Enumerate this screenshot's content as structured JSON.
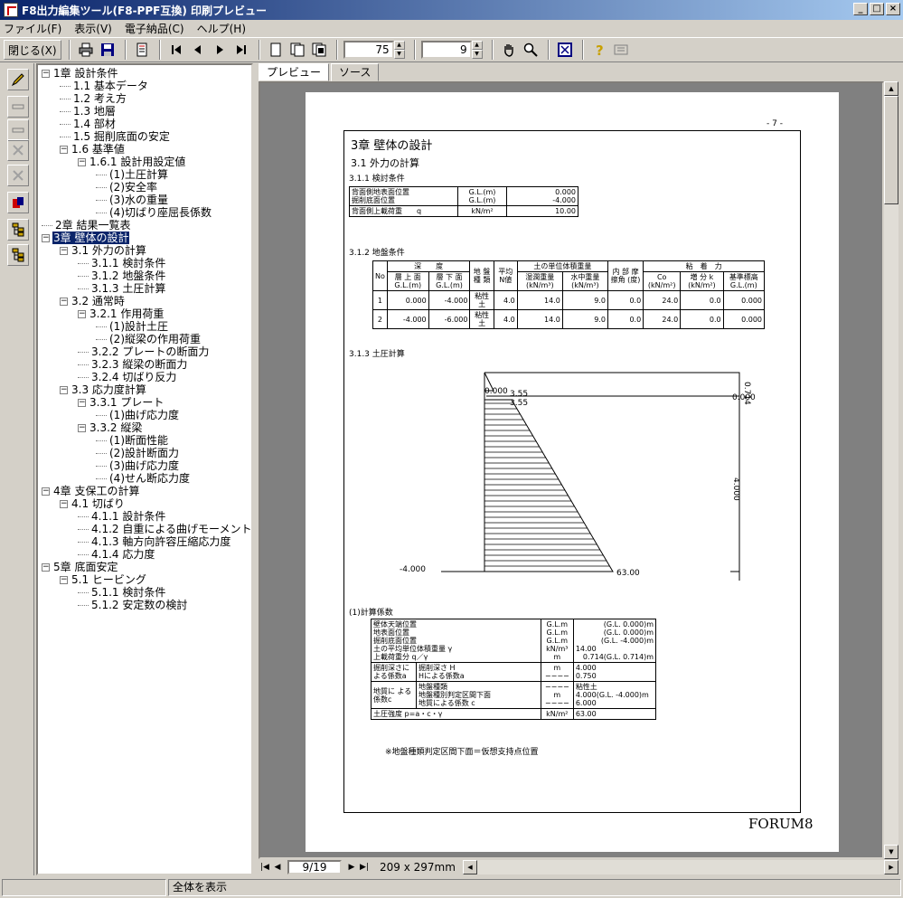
{
  "window": {
    "title": "F8出力編集ツール(F8-PPF互換) 印刷プレビュー"
  },
  "menu": [
    "ファイル(F)",
    "表示(V)",
    "電子納品(C)",
    "ヘルプ(H)"
  ],
  "toolbar": {
    "close_label": "閉じる(X)",
    "zoom_value": "75",
    "page_count_value": "9"
  },
  "tree": [
    {
      "label": "1章 設計条件",
      "level": 0,
      "box": "−"
    },
    {
      "label": "1.1 基本データ",
      "level": 1
    },
    {
      "label": "1.2 考え方",
      "level": 1
    },
    {
      "label": "1.3 地層",
      "level": 1
    },
    {
      "label": "1.4 部材",
      "level": 1
    },
    {
      "label": "1.5 掘削底面の安定",
      "level": 1
    },
    {
      "label": "1.6 基準値",
      "level": 1,
      "box": "−"
    },
    {
      "label": "1.6.1 設計用設定値",
      "level": 2,
      "box": "−"
    },
    {
      "label": "(1)土圧計算",
      "level": 3
    },
    {
      "label": "(2)安全率",
      "level": 3
    },
    {
      "label": "(3)水の重量",
      "level": 3
    },
    {
      "label": "(4)切ばり座屈長係数",
      "level": 3
    },
    {
      "label": "2章 結果一覧表",
      "level": 0
    },
    {
      "label": "3章 壁体の設計",
      "level": 0,
      "box": "−",
      "selected": true
    },
    {
      "label": "3.1 外力の計算",
      "level": 1,
      "box": "−"
    },
    {
      "label": "3.1.1 検討条件",
      "level": 2
    },
    {
      "label": "3.1.2 地盤条件",
      "level": 2
    },
    {
      "label": "3.1.3 土圧計算",
      "level": 2
    },
    {
      "label": "3.2 通常時",
      "level": 1,
      "box": "−"
    },
    {
      "label": "3.2.1 作用荷重",
      "level": 2,
      "box": "−"
    },
    {
      "label": "(1)設計土圧",
      "level": 3
    },
    {
      "label": "(2)縦梁の作用荷重",
      "level": 3
    },
    {
      "label": "3.2.2 プレートの断面力",
      "level": 2
    },
    {
      "label": "3.2.3 縦梁の断面力",
      "level": 2
    },
    {
      "label": "3.2.4 切ばり反力",
      "level": 2
    },
    {
      "label": "3.3 応力度計算",
      "level": 1,
      "box": "−"
    },
    {
      "label": "3.3.1 プレート",
      "level": 2,
      "box": "−"
    },
    {
      "label": "(1)曲げ応力度",
      "level": 3
    },
    {
      "label": "3.3.2 縦梁",
      "level": 2,
      "box": "−"
    },
    {
      "label": "(1)断面性能",
      "level": 3
    },
    {
      "label": "(2)設計断面力",
      "level": 3
    },
    {
      "label": "(3)曲げ応力度",
      "level": 3
    },
    {
      "label": "(4)せん断応力度",
      "level": 3
    },
    {
      "label": "4章 支保工の計算",
      "level": 0,
      "box": "−"
    },
    {
      "label": "4.1 切ばり",
      "level": 1,
      "box": "−"
    },
    {
      "label": "4.1.1 設計条件",
      "level": 2
    },
    {
      "label": "4.1.2 自重による曲げモーメント",
      "level": 2
    },
    {
      "label": "4.1.3 軸方向許容圧縮応力度",
      "level": 2
    },
    {
      "label": "4.1.4 応力度",
      "level": 2
    },
    {
      "label": "5章 底面安定",
      "level": 0,
      "box": "−"
    },
    {
      "label": "5.1 ヒービング",
      "level": 1,
      "box": "−"
    },
    {
      "label": "5.1.1 検討条件",
      "level": 2
    },
    {
      "label": "5.1.2 安定数の検討",
      "level": 2
    }
  ],
  "tabs": [
    "プレビュー",
    "ソース"
  ],
  "nav": {
    "page": "9/19",
    "paper": "209 x 297mm"
  },
  "status": {
    "message": "全体を表示"
  },
  "page": {
    "page_number": "- 7 -",
    "h1": "3章 壁体の設計",
    "h2": "3.1 外力の計算",
    "s311": "3.1.1 検討条件",
    "s312": "3.1.2 地盤条件",
    "s313": "3.1.3 土圧計算",
    "s_coef": "(1)計算係数",
    "brand": "FORUM8",
    "note": "※地盤種類判定区間下面＝仮想支持点位置",
    "t1": {
      "r1a": "背面側地表面位置",
      "r1b": "掘削底面位置",
      "u1a": "G.L.(m)",
      "u1b": "G.L.(m)",
      "v1a": "0.000",
      "v1b": "-4.000",
      "r2": "背面側上載荷重",
      "r2sym": "q",
      "u2": "kN/m²",
      "v2": "10.00"
    },
    "t2": {
      "h_no": "No",
      "h_depth": "深　　度",
      "h_top": "層 上 面 G.L.(m)",
      "h_bot": "層 下 面 G.L.(m)",
      "h_soil": "地 盤 種 類",
      "h_n": "平均 N値",
      "h_uw": "土の単位体積重量",
      "h_wet": "湿潤重量 (kN/m³)",
      "h_sub": "水中重量 (kN/m³)",
      "h_phi": "内 部 摩擦角 (度)",
      "h_coh": "粘　着　力",
      "h_co": "Co (kN/m²)",
      "h_k": "増 分 k (kN/m²)",
      "h_base": "基準標高 G.L.(m)",
      "rows": [
        {
          "no": "1",
          "top": "0.000",
          "bot": "-4.000",
          "soil": "粘性土",
          "n": "4.0",
          "wet": "14.0",
          "sub": "9.0",
          "phi": "0.0",
          "co": "24.0",
          "k": "0.0",
          "base": "0.000"
        },
        {
          "no": "2",
          "top": "-4.000",
          "bot": "-6.000",
          "soil": "粘性土",
          "n": "4.0",
          "wet": "14.0",
          "sub": "9.0",
          "phi": "0.0",
          "co": "24.0",
          "k": "0.0",
          "base": "0.000"
        }
      ]
    },
    "diagram": {
      "top_label": "0.000",
      "val_top1": "3.55",
      "val_top2": "3.55",
      "right_top": "0.714",
      "right_top2": "0.000",
      "right_mid": "4.000",
      "bottom_label": "-4.000",
      "val_bottom": "63.00"
    },
    "t3": {
      "a1": "壁体天端位置",
      "a2": "地表面位置",
      "a3": "掘削底面位置",
      "a4": "土の平均単位体積重量 γ",
      "a5": "上載荷重分 q／γ",
      "ua1": "G.L.m",
      "ua2": "G.L.m",
      "ua3": "G.L.m",
      "ua4": "kN/m³",
      "ua5": "m",
      "va1": "(G.L. 0.000)m",
      "va2": "(G.L. 0.000)m",
      "va3": "(G.L. -4.000)m",
      "va4": "14.00",
      "va5": "0.714(G.L. 0.714)m",
      "b_label": "掘削深さに よる係数a",
      "b1": "掘削深さ H",
      "b2": "Hによる係数a",
      "ub1": "m",
      "ub2": "−−−−",
      "vb1": "4.000",
      "vb2": "0.750",
      "c_label": "地質に よる係数c",
      "c1": "地盤種類",
      "c2": "地盤種別判定区間下面",
      "c3": "地質による係数 c",
      "uc1": "−−−−",
      "uc2": "m",
      "uc3": "−−−−",
      "vc1": "粘性土",
      "vc2": "4.000(G.L. -4.000)m",
      "vc3": "6.000",
      "d1": "土圧強度 p=a・c・γ",
      "ud1": "kN/m²",
      "vd1": "63.00"
    }
  }
}
